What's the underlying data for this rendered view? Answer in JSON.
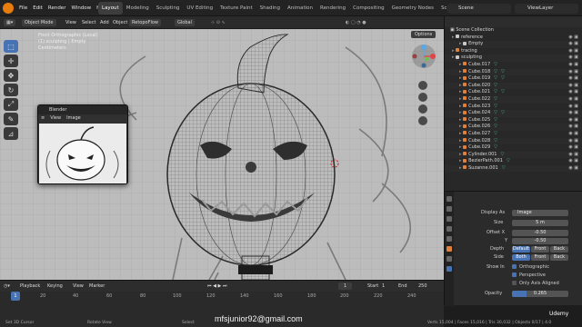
{
  "menu": [
    "File",
    "Edit",
    "Render",
    "Window",
    "Help"
  ],
  "workspaces": [
    "Layout",
    "Modeling",
    "Sculpting",
    "UV Editing",
    "Texture Paint",
    "Shading",
    "Animation",
    "Rendering",
    "Compositing",
    "Geometry Nodes",
    "Scripting"
  ],
  "scene": {
    "scene_label": "Scene",
    "view_layer_label": "ViewLayer"
  },
  "viewport_header": {
    "mode": "Object Mode",
    "view": "View",
    "select": "Select",
    "add": "Add",
    "object": "Object",
    "retopoflow": "RetopoFlow",
    "orientation": "Global",
    "options": "Options"
  },
  "viewport_info": {
    "line1": "Front Orthographic (Local)",
    "line2": "(1) sculpting | Empty",
    "line3": "Centimeters"
  },
  "render_window": {
    "title": "Blender",
    "view": "View",
    "image": "Image",
    "menu_icon": "≡"
  },
  "timeline": {
    "playback": "Playback",
    "keying": "Keying",
    "view": "View",
    "marker": "Marker",
    "current_frame": "1",
    "start_label": "Start",
    "start": "1",
    "end_label": "End",
    "end": "250",
    "ruler": [
      "1",
      "20",
      "40",
      "60",
      "80",
      "100",
      "120",
      "140",
      "160",
      "180",
      "200",
      "220",
      "240"
    ]
  },
  "status": {
    "left": "Set 3D Cursor",
    "mid": "Rotate View",
    "select": "Select",
    "right": "Verts 15,004 | Faces 15,016 | Tris 30,032 | Objects 0/17 | 4.0",
    "watermark": "mfsjunior92@gmail.com",
    "udemy": "Udemy"
  },
  "outliner": {
    "title": "Scene Collection",
    "items": [
      {
        "label": "reference",
        "indent": 1,
        "color": "#c9c9c9",
        "tris": 0
      },
      {
        "label": "Empty",
        "indent": 2,
        "color": "#c9c9c9",
        "tris": 0
      },
      {
        "label": "tracing",
        "indent": 1,
        "color": "#e0803a",
        "tris": 0
      },
      {
        "label": "sculpting",
        "indent": 1,
        "color": "#c9c9c9",
        "tris": 0
      },
      {
        "label": "Cube.017",
        "indent": 2,
        "color": "#e0803a",
        "tris": 1
      },
      {
        "label": "Cube.018",
        "indent": 2,
        "color": "#e0803a",
        "tris": 2
      },
      {
        "label": "Cube.019",
        "indent": 2,
        "color": "#e0803a",
        "tris": 2
      },
      {
        "label": "Cube.020",
        "indent": 2,
        "color": "#e0803a",
        "tris": 1
      },
      {
        "label": "Cube.021",
        "indent": 2,
        "color": "#e0803a",
        "tris": 2
      },
      {
        "label": "Cube.022",
        "indent": 2,
        "color": "#e0803a",
        "tris": 1
      },
      {
        "label": "Cube.023",
        "indent": 2,
        "color": "#e0803a",
        "tris": 1
      },
      {
        "label": "Cube.024",
        "indent": 2,
        "color": "#e0803a",
        "tris": 2
      },
      {
        "label": "Cube.025",
        "indent": 2,
        "color": "#e0803a",
        "tris": 1
      },
      {
        "label": "Cube.026",
        "indent": 2,
        "color": "#e0803a",
        "tris": 1
      },
      {
        "label": "Cube.027",
        "indent": 2,
        "color": "#e0803a",
        "tris": 1
      },
      {
        "label": "Cube.028",
        "indent": 2,
        "color": "#e0803a",
        "tris": 1
      },
      {
        "label": "Cube.029",
        "indent": 2,
        "color": "#e0803a",
        "tris": 1
      },
      {
        "label": "Cylinder.001",
        "indent": 2,
        "color": "#e0803a",
        "tris": 1
      },
      {
        "label": "BezierPath.001",
        "indent": 2,
        "color": "#e0803a",
        "tris": 1
      },
      {
        "label": "Suzanne.001",
        "indent": 2,
        "color": "#e0803a",
        "tris": 1
      }
    ]
  },
  "properties": {
    "display_as_label": "Display As",
    "display_as": "Image",
    "size_label": "Size",
    "size": "5 m",
    "offset_x_label": "Offset X",
    "offset_x": "-0.50",
    "y_label": "Y",
    "offset_y": "-0.50",
    "depth_label": "Depth",
    "depth": [
      "Default",
      "Front",
      "Back"
    ],
    "side_label": "Side",
    "side": [
      "Both",
      "Front",
      "Back"
    ],
    "show_in_label": "Show In",
    "orthographic": "Orthographic",
    "perspective": "Perspective",
    "axis_aligned": "Only Axis Aligned",
    "opacity_label": "Opacity",
    "opacity": "0.265"
  },
  "colors": {
    "accent": "#4772b3",
    "orange": "#e0803a",
    "blender_logo": "#e87d0d"
  }
}
